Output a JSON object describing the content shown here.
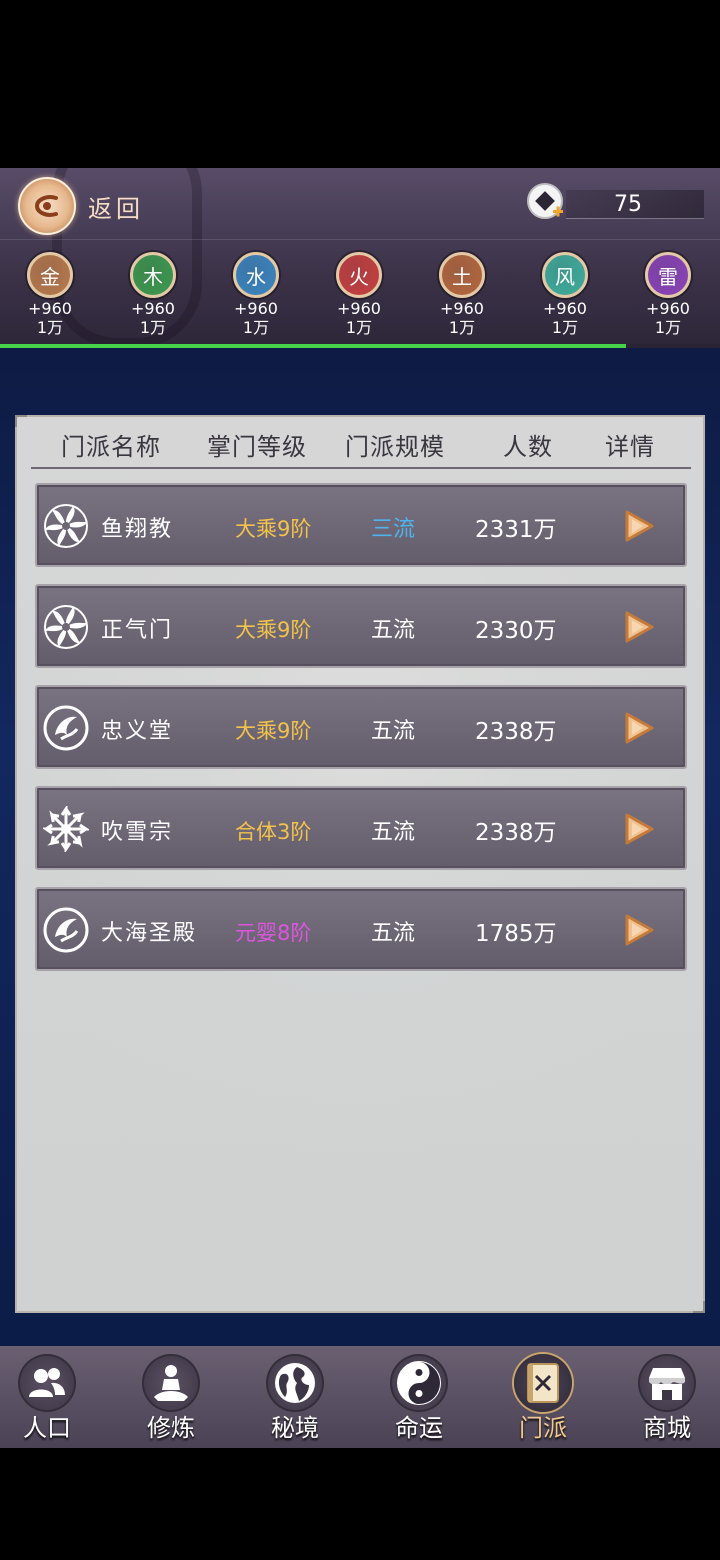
{
  "topbar": {
    "back_label": "返回",
    "currency_value": "75"
  },
  "elements": [
    {
      "char": "金",
      "bonus": "+960",
      "amount": "1万",
      "color": "#b87a4c"
    },
    {
      "char": "木",
      "bonus": "+960",
      "amount": "1万",
      "color": "#3c9a4e"
    },
    {
      "char": "水",
      "bonus": "+960",
      "amount": "1万",
      "color": "#3b86bf"
    },
    {
      "char": "火",
      "bonus": "+960",
      "amount": "1万",
      "color": "#c6403f"
    },
    {
      "char": "土",
      "bonus": "+960",
      "amount": "1万",
      "color": "#b5683e"
    },
    {
      "char": "风",
      "bonus": "+960",
      "amount": "1万",
      "color": "#3fae9c"
    },
    {
      "char": "雷",
      "bonus": "+960",
      "amount": "1万",
      "color": "#8a44b8"
    }
  ],
  "element_progress": 0.87,
  "table": {
    "headers": [
      "门派名称",
      "掌门等级",
      "门派规模",
      "人数",
      "详情"
    ],
    "rows": [
      {
        "name": "鱼翔教",
        "rank": "大乘9阶",
        "rank_color": "#f3c24a",
        "scale": "三流",
        "scale_color": "#4fb4ee",
        "members": "2331万",
        "icon": "swirl-sect-icon"
      },
      {
        "name": "正气门",
        "rank": "大乘9阶",
        "rank_color": "#f3c24a",
        "scale": "五流",
        "scale_color": "#ffffff",
        "members": "2330万",
        "icon": "swirl-sect-icon"
      },
      {
        "name": "忠义堂",
        "rank": "大乘9阶",
        "rank_color": "#f3c24a",
        "scale": "五流",
        "scale_color": "#ffffff",
        "members": "2338万",
        "icon": "phoenix-sect-icon"
      },
      {
        "name": "吹雪宗",
        "rank": "合体3阶",
        "rank_color": "#f3c24a",
        "scale": "五流",
        "scale_color": "#ffffff",
        "members": "2338万",
        "icon": "snowflake-sect-icon"
      },
      {
        "name": "大海圣殿",
        "rank": "元婴8阶",
        "rank_color": "#e055e0",
        "scale": "五流",
        "scale_color": "#ffffff",
        "members": "1785万",
        "icon": "phoenix-sect-icon"
      }
    ]
  },
  "nav": [
    {
      "label": "人口",
      "icon": "people-icon"
    },
    {
      "label": "修炼",
      "icon": "meditation-icon"
    },
    {
      "label": "秘境",
      "icon": "globe-icon"
    },
    {
      "label": "命运",
      "icon": "yin-yang-icon"
    },
    {
      "label": "门派",
      "icon": "sect-book-icon",
      "active": true
    },
    {
      "label": "商城",
      "icon": "shop-icon"
    }
  ]
}
